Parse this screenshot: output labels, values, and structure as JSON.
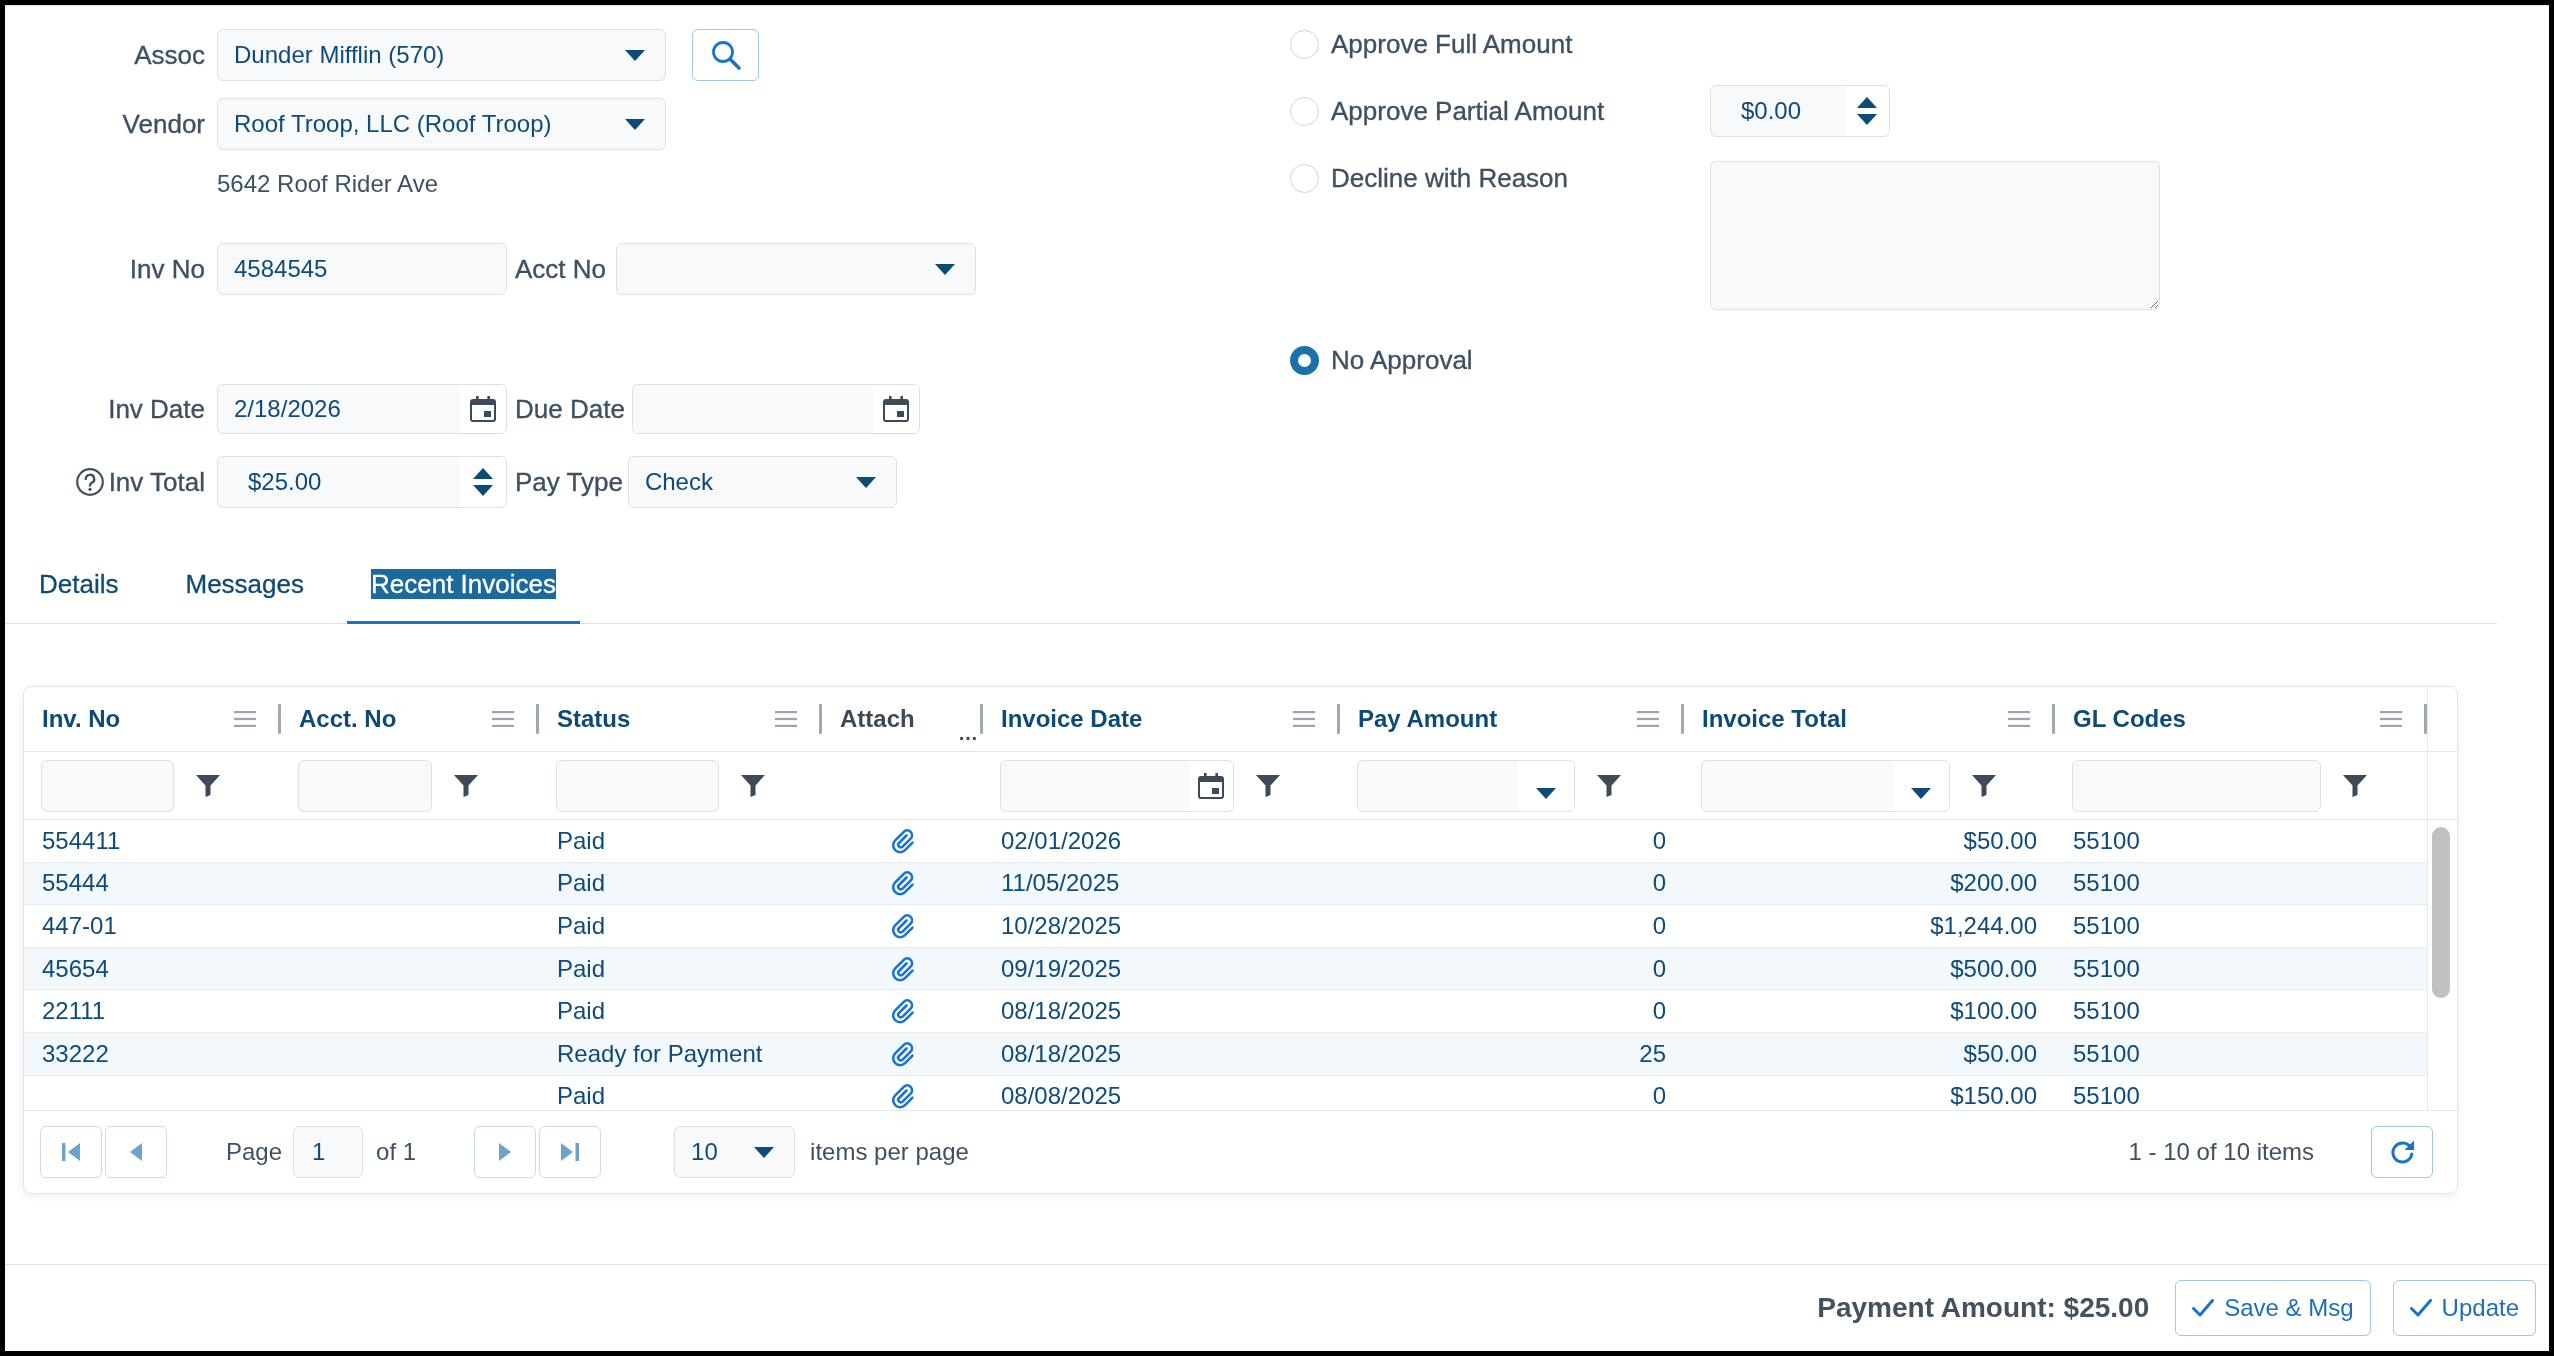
{
  "form": {
    "assoc": {
      "label": "Assoc",
      "value": "Dunder Mifflin (570)"
    },
    "vendor": {
      "label": "Vendor",
      "value": "Roof Troop, LLC (Roof Troop)",
      "address": "5642 Roof Rider Ave"
    },
    "inv_no": {
      "label": "Inv No",
      "value": "4584545"
    },
    "acct_no": {
      "label": "Acct No"
    },
    "inv_date": {
      "label": "Inv Date",
      "value": "2/18/2026"
    },
    "due_date": {
      "label": "Due Date"
    },
    "inv_total": {
      "label": "Inv Total",
      "value": "$25.00"
    },
    "pay_type": {
      "label": "Pay Type",
      "value": "Check"
    }
  },
  "approval_options": [
    {
      "label": "Approve Full Amount",
      "selected": false,
      "kind": "plain"
    },
    {
      "label": "Approve Partial Amount",
      "selected": false,
      "kind": "amount",
      "value": "$0.00"
    },
    {
      "label": "Decline with Reason",
      "selected": false,
      "kind": "reason"
    },
    {
      "label": "No Approval",
      "selected": true,
      "kind": "plain"
    }
  ],
  "tabs": [
    {
      "label": "Details",
      "selected": false
    },
    {
      "label": "Messages",
      "selected": false
    },
    {
      "label": "Recent Invoices",
      "selected": true
    }
  ],
  "grid": {
    "columns": [
      {
        "title": "Inv. No",
        "kind": "sortable",
        "filter": {
          "kind": "text"
        }
      },
      {
        "title": "Acct. No",
        "kind": "sortable",
        "filter": {
          "kind": "text"
        }
      },
      {
        "title": "Status",
        "kind": "sortable",
        "filter": {
          "kind": "text"
        }
      },
      {
        "title": "Attach",
        "kind": "static",
        "overflow": "…"
      },
      {
        "title": "Invoice Date",
        "kind": "sortable",
        "filter": {
          "kind": "date"
        }
      },
      {
        "title": "Pay Amount",
        "kind": "sortable",
        "filter": {
          "kind": "dropdown"
        }
      },
      {
        "title": "Invoice Total",
        "kind": "sortable",
        "filter": {
          "kind": "dropdown"
        }
      },
      {
        "title": "GL Codes",
        "kind": "sortable",
        "filter": {
          "kind": "text"
        }
      }
    ],
    "rows": [
      {
        "inv_no": "554411",
        "status": "Paid",
        "attachment": true,
        "invoice_date": "02/01/2026",
        "pay_amount": "0",
        "invoice_total": "$50.00",
        "gl_codes": "55100"
      },
      {
        "inv_no": "55444",
        "status": "Paid",
        "attachment": true,
        "invoice_date": "11/05/2025",
        "pay_amount": "0",
        "invoice_total": "$200.00",
        "gl_codes": "55100"
      },
      {
        "inv_no": "447-01",
        "status": "Paid",
        "attachment": true,
        "invoice_date": "10/28/2025",
        "pay_amount": "0",
        "invoice_total": "$1,244.00",
        "gl_codes": "55100"
      },
      {
        "inv_no": "45654",
        "status": "Paid",
        "attachment": true,
        "invoice_date": "09/19/2025",
        "pay_amount": "0",
        "invoice_total": "$500.00",
        "gl_codes": "55100"
      },
      {
        "inv_no": "22111",
        "status": "Paid",
        "attachment": true,
        "invoice_date": "08/18/2025",
        "pay_amount": "0",
        "invoice_total": "$100.00",
        "gl_codes": "55100"
      },
      {
        "inv_no": "33222",
        "status": "Ready for Payment",
        "attachment": true,
        "invoice_date": "08/18/2025",
        "pay_amount": "25",
        "invoice_total": "$50.00",
        "gl_codes": "55100"
      },
      {
        "status": "Paid",
        "attachment": true,
        "invoice_date": "08/08/2025",
        "pay_amount": "0",
        "invoice_total": "$150.00",
        "gl_codes": "55100"
      }
    ],
    "pager": {
      "back_buttons": [
        {
          "kind": "first",
          "disabled": true
        },
        {
          "kind": "previous",
          "disabled": true
        }
      ],
      "page_label": "Page",
      "page": "1",
      "page_count": "of 1",
      "forward_buttons": [
        {
          "kind": "next",
          "disabled": true
        },
        {
          "kind": "last",
          "disabled": true
        }
      ],
      "page_size": "10",
      "page_size_label": "items per page",
      "summary": "1 - 10 of 10 items"
    }
  },
  "footer": {
    "payment_amount": "Payment Amount: $25.00",
    "buttons": [
      "Save & Msg",
      "Update"
    ]
  }
}
